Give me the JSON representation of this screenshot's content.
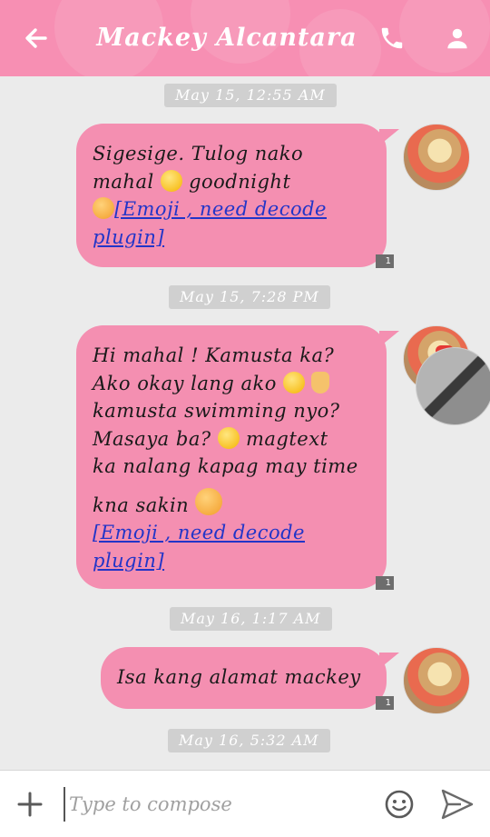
{
  "header": {
    "title": "Mackey Alcantara",
    "back_icon": "back-arrow-icon",
    "call_icon": "phone-icon",
    "profile_icon": "person-icon",
    "color": "#f78fb3"
  },
  "messages": [
    {
      "timestamp": "May 15, 12:55 AM",
      "lines": [
        "Sigesige. Tulog nako",
        "mahal",
        "goodnight"
      ],
      "link": [
        "[Emoji , need decode",
        "plugin]"
      ],
      "receipt": "1"
    },
    {
      "timestamp": "May 15, 7:28 PM",
      "lines": [
        "Hi mahal ! Kamusta ka?",
        "Ako okay lang ako",
        "kamusta swimming nyo?",
        "Masaya ba?",
        "magtext",
        "ka nalang kapag may time",
        "kna sakin"
      ],
      "link": [
        "[Emoji , need decode",
        "plugin]"
      ],
      "receipt": "1"
    },
    {
      "timestamp": "May 16, 1:17 AM",
      "lines": [
        "Isa kang alamat mackey"
      ],
      "receipt": "1"
    },
    {
      "timestamp": "May 16, 5:32 AM"
    }
  ],
  "compose": {
    "placeholder": "Type to compose",
    "add_icon": "plus-icon",
    "emoji_icon": "smiley-icon",
    "send_icon": "send-icon"
  },
  "colors": {
    "bubble": "#f48fb1",
    "link": "#2235c8",
    "background": "#ebebeb"
  }
}
